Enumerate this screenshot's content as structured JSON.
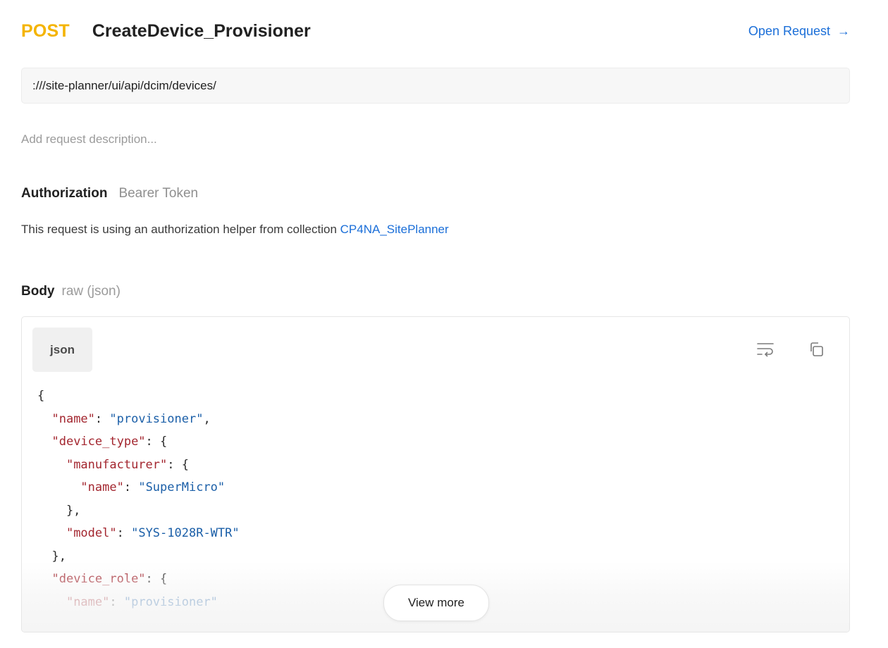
{
  "request": {
    "method": "POST",
    "name": "CreateDevice_Provisioner",
    "open_label": "Open Request",
    "open_arrow": "→",
    "url": ":///site-planner/ui/api/dcim/devices/",
    "description_placeholder": "Add request description..."
  },
  "authorization": {
    "heading": "Authorization",
    "type": "Bearer Token",
    "note_prefix": "This request is using an authorization helper from collection",
    "collection": "CP4NA_SitePlanner"
  },
  "body": {
    "heading": "Body",
    "mode": "raw (json)",
    "language": "json",
    "view_more": "View more",
    "lines": [
      [
        {
          "t": "p",
          "v": "{"
        }
      ],
      [
        {
          "t": "p",
          "v": "  "
        },
        {
          "t": "k",
          "v": "\"name\""
        },
        {
          "t": "p",
          "v": ": "
        },
        {
          "t": "s",
          "v": "\"provisioner\""
        },
        {
          "t": "p",
          "v": ","
        }
      ],
      [
        {
          "t": "p",
          "v": "  "
        },
        {
          "t": "k",
          "v": "\"device_type\""
        },
        {
          "t": "p",
          "v": ": {"
        }
      ],
      [
        {
          "t": "p",
          "v": "    "
        },
        {
          "t": "k",
          "v": "\"manufacturer\""
        },
        {
          "t": "p",
          "v": ": {"
        }
      ],
      [
        {
          "t": "p",
          "v": "      "
        },
        {
          "t": "k",
          "v": "\"name\""
        },
        {
          "t": "p",
          "v": ": "
        },
        {
          "t": "s",
          "v": "\"SuperMicro\""
        }
      ],
      [
        {
          "t": "p",
          "v": "    },"
        }
      ],
      [
        {
          "t": "p",
          "v": "    "
        },
        {
          "t": "k",
          "v": "\"model\""
        },
        {
          "t": "p",
          "v": ": "
        },
        {
          "t": "s",
          "v": "\"SYS-1028R-WTR\""
        }
      ],
      [
        {
          "t": "p",
          "v": "  },"
        }
      ],
      [
        {
          "t": "p",
          "v": "  "
        },
        {
          "t": "k",
          "v": "\"device_role\""
        },
        {
          "t": "p",
          "v": ": {"
        }
      ],
      [
        {
          "t": "p",
          "v": "    "
        },
        {
          "t": "k",
          "v": "\"name\""
        },
        {
          "t": "p",
          "v": ": "
        },
        {
          "t": "s",
          "v": "\"provisioner\""
        }
      ]
    ]
  },
  "icons": {
    "wrap": "text-wrap-icon",
    "copy": "copy-icon",
    "open": "arrow-right-icon"
  },
  "colors": {
    "method": "#f4b400",
    "link": "#1a6ed8",
    "json_key": "#a3262f",
    "json_string": "#1b5fa8"
  }
}
